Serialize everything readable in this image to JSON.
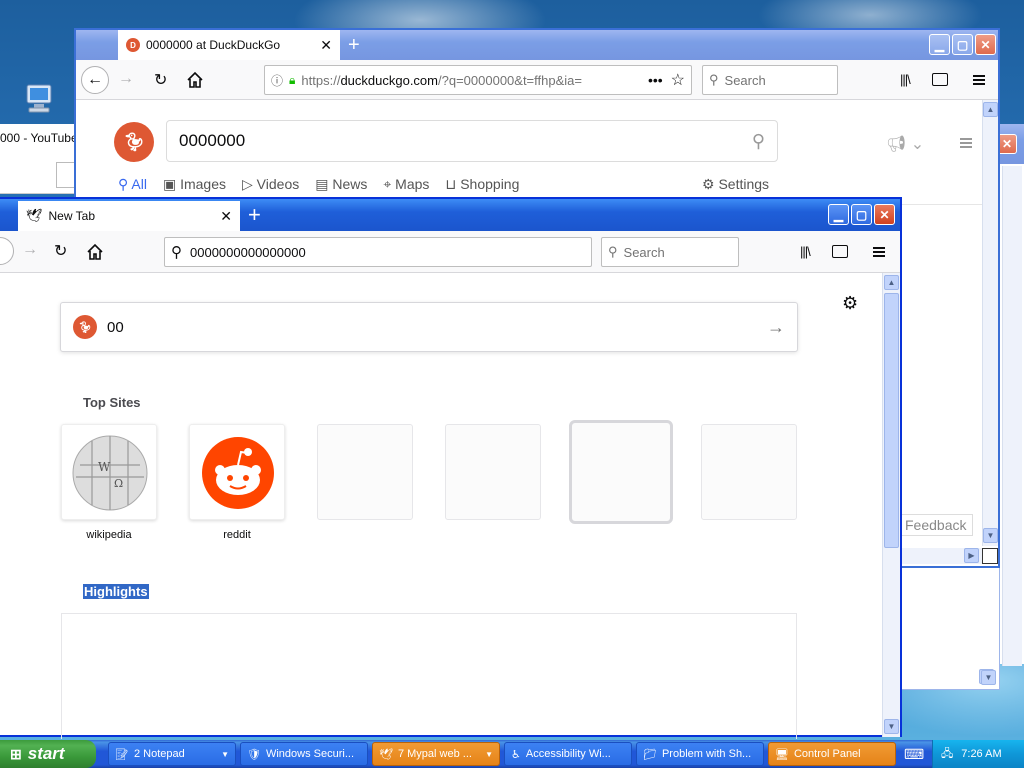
{
  "desktop": {
    "icon_name": "my-computer-icon"
  },
  "left_window": {
    "title_fragment": "000 - YouTube"
  },
  "back_window": {
    "tab_title": "0000000 at DuckDuckGo",
    "url_prefix": "https://",
    "url_host": "duckduckgo.com",
    "url_rest": "/?q=0000000&t=ffhp&ia=",
    "search_placeholder": "Search",
    "ddg_query": "0000000",
    "nav_items": [
      {
        "label": "All",
        "icon": "search-icon"
      },
      {
        "label": "Images",
        "icon": "image-icon"
      },
      {
        "label": "Videos",
        "icon": "play-icon"
      },
      {
        "label": "News",
        "icon": "news-icon"
      },
      {
        "label": "Maps",
        "icon": "map-pin-icon"
      },
      {
        "label": "Shopping",
        "icon": "shopping-bag-icon"
      }
    ],
    "settings_label": "Settings",
    "feedback_label": "Feedback"
  },
  "front_window": {
    "tab_title": "New Tab",
    "url_value": "0000000000000000",
    "search_placeholder": "Search",
    "content_search_value": "00",
    "top_sites_heading": "Top Sites",
    "top_sites": [
      {
        "label": "wikipedia"
      },
      {
        "label": "reddit"
      },
      {
        "label": ""
      },
      {
        "label": ""
      },
      {
        "label": ""
      },
      {
        "label": ""
      }
    ],
    "highlights_heading": "Highlights"
  },
  "taskbar": {
    "start_label": "start",
    "items": [
      {
        "label": "2 Notepad",
        "icon": "notepad-icon",
        "active": false
      },
      {
        "label": "Windows Securi...",
        "icon": "shield-icon",
        "active": false
      },
      {
        "label": "7 Mypal web ...",
        "icon": "browser-icon",
        "active": true
      },
      {
        "label": "Accessibility Wi...",
        "icon": "accessibility-icon",
        "active": false
      },
      {
        "label": "Problem with Sh...",
        "icon": "folder-icon",
        "active": false
      },
      {
        "label": "Control Panel",
        "icon": "control-panel-icon",
        "active": true
      }
    ],
    "clock": "7:26 AM"
  }
}
